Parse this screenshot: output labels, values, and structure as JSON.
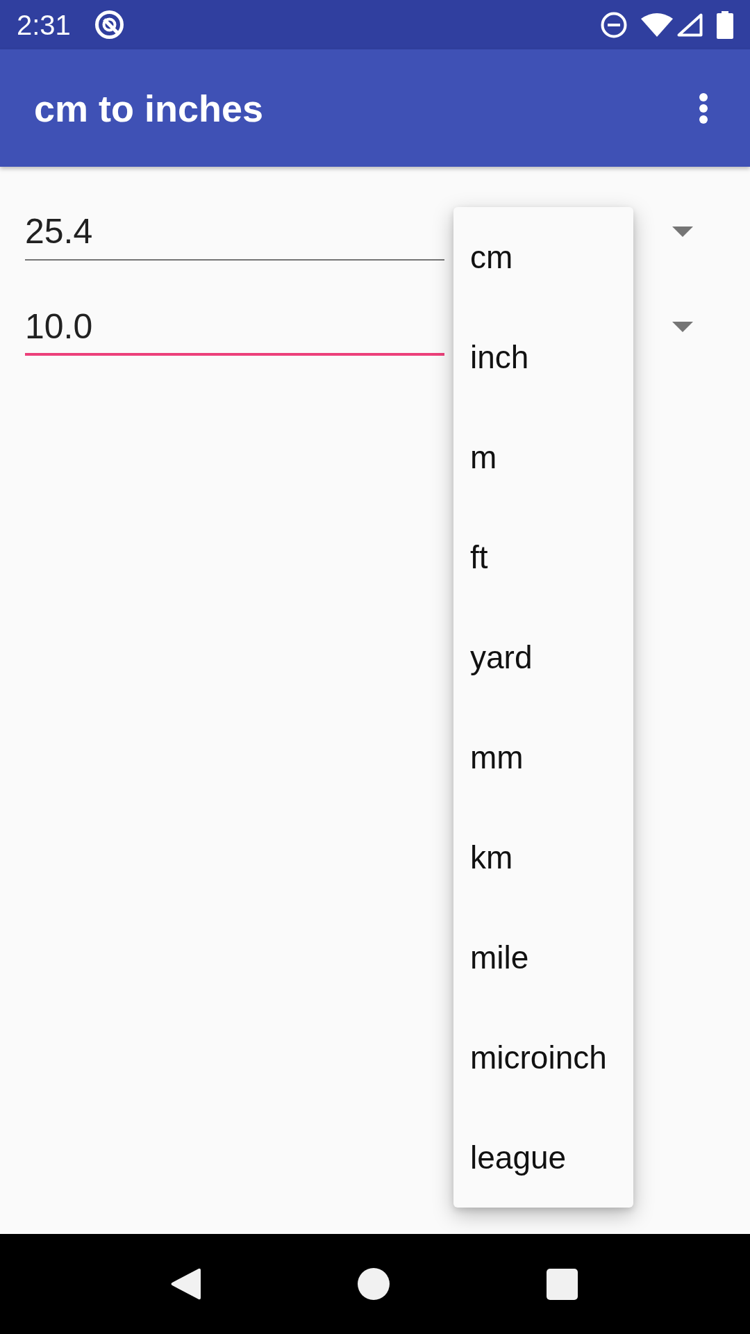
{
  "status_bar": {
    "time": "2:31"
  },
  "app_bar": {
    "title": "cm to inches"
  },
  "fields": [
    {
      "value": "25.4",
      "focused": false
    },
    {
      "value": "10.0",
      "focused": true
    }
  ],
  "dropdown_menu": {
    "items": [
      {
        "label": "cm"
      },
      {
        "label": "inch"
      },
      {
        "label": "m"
      },
      {
        "label": "ft"
      },
      {
        "label": "yard"
      },
      {
        "label": "mm"
      },
      {
        "label": "km"
      },
      {
        "label": "mile"
      },
      {
        "label": "microinch"
      },
      {
        "label": "league"
      }
    ]
  }
}
